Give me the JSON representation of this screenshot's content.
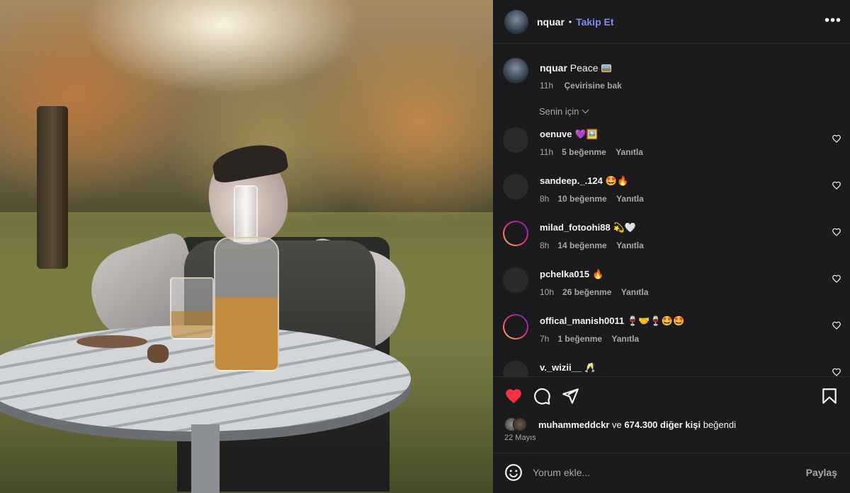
{
  "post": {
    "username": "nquar",
    "follow_label": "Takip Et",
    "separator": "•",
    "more_label": "•••"
  },
  "caption": {
    "username": "nquar",
    "text": "Peace",
    "time": "11h",
    "translate_label": "Çevirisine bak"
  },
  "filter": {
    "label": "Senin için"
  },
  "comments": [
    {
      "user": "oenuve",
      "emoji": "💜🖼️",
      "time": "11h",
      "likes": "5 beğenme",
      "reply": "Yanıtla",
      "ring": false
    },
    {
      "user": "sandeep._.124",
      "emoji": "🤩🔥",
      "time": "8h",
      "likes": "10 beğenme",
      "reply": "Yanıtla",
      "ring": false
    },
    {
      "user": "milad_fotoohi88",
      "emoji": "💫🤍",
      "time": "8h",
      "likes": "14 beğenme",
      "reply": "Yanıtla",
      "ring": true
    },
    {
      "user": "pchelka015",
      "emoji": "🔥",
      "time": "10h",
      "likes": "26 beğenme",
      "reply": "Yanıtla",
      "ring": false
    },
    {
      "user": "offical_manish0011",
      "emoji": "🍷🤝🍷🤩🤩",
      "time": "7h",
      "likes": "1 beğenme",
      "reply": "Yanıtla",
      "ring": true
    },
    {
      "user": "v._wizii__",
      "emoji": "🥂",
      "time": "",
      "likes": "",
      "reply": "",
      "ring": false
    }
  ],
  "likes": {
    "user": "muhammeddckr",
    "connector": "ve",
    "count": "674.300 diğer kişi",
    "suffix": "beğendi"
  },
  "date": "22 Mayıs",
  "composer": {
    "placeholder": "Yorum ekle...",
    "share_label": "Paylaş"
  },
  "colors": {
    "background": "#1b1b1d",
    "follow": "#7f8cf8",
    "liked_heart": "#ff3040",
    "muted_text": "#a8a8a8"
  },
  "icons": {
    "like": "heart-filled-icon",
    "comment": "speech-bubble-icon",
    "share": "paper-plane-icon",
    "save": "bookmark-icon",
    "emoji": "smiley-icon",
    "more": "ellipsis-icon"
  }
}
